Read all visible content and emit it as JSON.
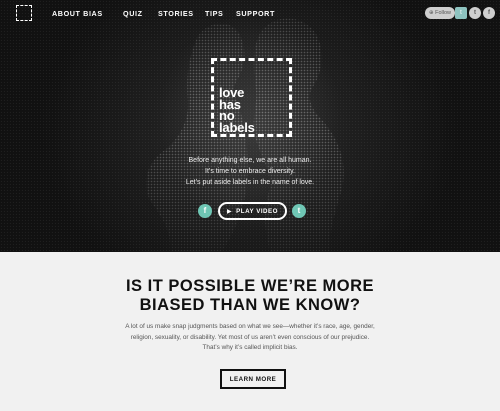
{
  "nav": {
    "items": [
      "ABOUT BIAS",
      "QUIZ",
      "STORIES",
      "TIPS",
      "SUPPORT"
    ],
    "follow_label": "Follow",
    "follow_badge": "t",
    "social_icons": [
      "twitter-icon",
      "facebook-icon"
    ]
  },
  "hero": {
    "logo_lines": [
      "love",
      "has",
      "no",
      "labels"
    ],
    "tagline_lines": [
      "Before anything else, we are all human.",
      "It’s time to embrace diversity.",
      "Let’s put aside labels in the name of love."
    ],
    "play_label": "PLAY VIDEO",
    "accent_color": "#6fc6b4"
  },
  "intro": {
    "headline_lines": [
      "IS IT POSSIBLE WE’RE MORE",
      "BIASED THAN WE KNOW?"
    ],
    "body_lines": [
      "A lot of us make snap judgments based on what we see—whether it’s race, age, gender,",
      "religion, sexuality, or disability. Yet most of us aren’t even conscious of our prejudice.",
      "That’s why it’s called implicit bias."
    ],
    "cta_label": "LEARN MORE"
  }
}
